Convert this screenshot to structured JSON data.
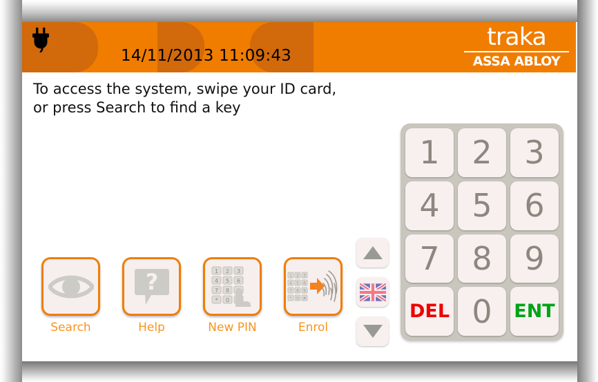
{
  "header": {
    "clock": "14/11/2013 11:09:43",
    "plug_icon": "power-plug-icon",
    "logo_word": "traka",
    "logo_sub": "ASSA ABLOY",
    "bg_color": "#f07d00",
    "watermark_color": "#d2690a"
  },
  "instruction": {
    "line1": "To access the system, swipe your ID card,",
    "line2": "or press Search to find a key"
  },
  "keypad": {
    "keys": [
      {
        "label": "1",
        "kind": "digit"
      },
      {
        "label": "2",
        "kind": "digit"
      },
      {
        "label": "3",
        "kind": "digit"
      },
      {
        "label": "4",
        "kind": "digit"
      },
      {
        "label": "5",
        "kind": "digit"
      },
      {
        "label": "6",
        "kind": "digit"
      },
      {
        "label": "7",
        "kind": "digit"
      },
      {
        "label": "8",
        "kind": "digit"
      },
      {
        "label": "9",
        "kind": "digit"
      },
      {
        "label": "DEL",
        "kind": "del"
      },
      {
        "label": "0",
        "kind": "digit"
      },
      {
        "label": "ENT",
        "kind": "ent"
      }
    ],
    "digit_color": "#8d877f",
    "del_color": "#ee0000",
    "ent_color": "#00a417",
    "panel_color": "#c9c6be",
    "key_color": "#f7f0ef"
  },
  "side_controls": {
    "up_icon": "triangle-up-icon",
    "flag_icon": "union-jack-flag-icon",
    "down_icon": "triangle-down-icon"
  },
  "actions": [
    {
      "label": "Search",
      "icon": "eye-icon"
    },
    {
      "label": "Help",
      "icon": "question-speech-bubble-icon"
    },
    {
      "label": "New PIN",
      "icon": "keypad-hand-icon"
    },
    {
      "label": "Enrol",
      "icon": "keypad-arrow-fingerprint-icon"
    }
  ],
  "theme": {
    "accent": "#f07d00",
    "label_orange": "#f7941e",
    "screen_bg": "#ffffff"
  }
}
